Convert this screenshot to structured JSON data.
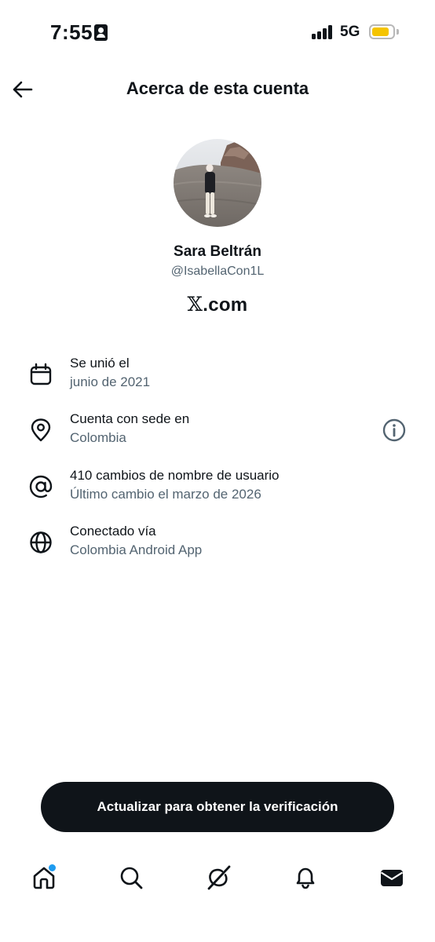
{
  "status_bar": {
    "time": "7:55",
    "network": "5G",
    "idcard_icon": "contact-card-icon",
    "signal_icon": "cellular-signal-icon",
    "battery_icon": "battery-icon",
    "battery_color": "#f5c400"
  },
  "header": {
    "title": "Acerca de esta cuenta",
    "back_icon": "arrow-left-icon"
  },
  "profile": {
    "name": "Sara Beltrán",
    "handle": "@IsabellaCon1L",
    "site_x": "𝕏",
    "site_rest": ".com"
  },
  "info_items": [
    {
      "icon": "calendar-icon",
      "label": "Se unió el",
      "value": "junio de 2021"
    },
    {
      "icon": "location-pin-icon",
      "label": "Cuenta con sede en",
      "value": "Colombia",
      "action_icon": "info-icon"
    },
    {
      "icon": "at-sign-icon",
      "label": "410 cambios de nombre de usuario",
      "value": "Último cambio el marzo de 2026"
    },
    {
      "icon": "globe-icon",
      "label": "Conectado vía",
      "value": "Colombia Android App"
    }
  ],
  "cta": {
    "label": "Actualizar para obtener la verificación"
  },
  "bottom_nav": {
    "items": [
      {
        "icon": "home-icon",
        "has_notification_dot": true
      },
      {
        "icon": "search-icon"
      },
      {
        "icon": "grok-icon"
      },
      {
        "icon": "bell-icon"
      },
      {
        "icon": "mail-icon"
      }
    ]
  },
  "colors": {
    "text_primary": "#0f1419",
    "text_secondary": "#536471",
    "accent": "#1d9bf0",
    "cta_background": "#0f1419"
  }
}
